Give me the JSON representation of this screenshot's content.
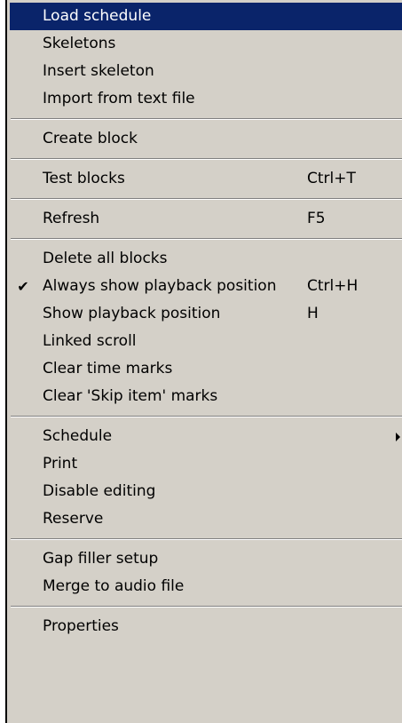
{
  "menu": {
    "load_schedule": "Load schedule",
    "skeletons": "Skeletons",
    "insert_skeleton": "Insert skeleton",
    "import_from_text_file": "Import from text file",
    "create_block": "Create block",
    "test_blocks": "Test blocks",
    "test_blocks_shortcut": "Ctrl+T",
    "refresh": "Refresh",
    "refresh_shortcut": "F5",
    "delete_all_blocks": "Delete all blocks",
    "always_show_playback_position": "Always show playback position",
    "always_show_playback_position_shortcut": "Ctrl+H",
    "checkmark": "✔",
    "show_playback_position": "Show playback position",
    "show_playback_position_shortcut": "H",
    "linked_scroll": "Linked scroll",
    "clear_time_marks": "Clear time marks",
    "clear_skip_item_marks": "Clear 'Skip item' marks",
    "schedule": "Schedule",
    "print": "Print",
    "disable_editing": "Disable editing",
    "reserve": "Reserve",
    "gap_filler_setup": "Gap filler setup",
    "merge_to_audio_file": "Merge to audio file",
    "properties": "Properties"
  },
  "colors": {
    "menu_background": "#d4d0c8",
    "highlight_background": "#0a246a",
    "highlight_text": "#ffffff",
    "text": "#000000"
  },
  "icons": {
    "check": "checkmark-icon",
    "submenu": "submenu-arrow-icon"
  }
}
